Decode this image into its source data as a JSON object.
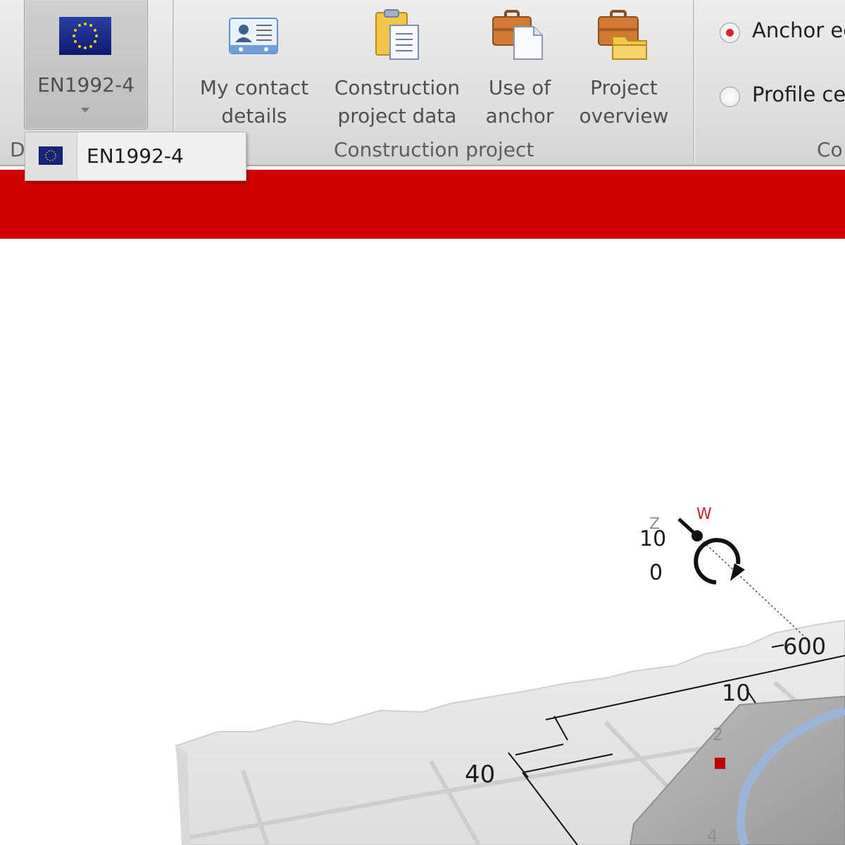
{
  "ribbon": {
    "standard": {
      "label": "EN1992-4",
      "icon": "eu-flag-icon"
    },
    "standard_group_label": "D",
    "construction_group": {
      "label": "Construction project",
      "buttons": [
        {
          "line1": "My contact",
          "line2": "details",
          "icon": "contact-card-icon"
        },
        {
          "line1": "Construction",
          "line2": "project data",
          "icon": "clipboard-document-icon"
        },
        {
          "line1": "Use of",
          "line2": "anchor",
          "icon": "briefcase-document-icon"
        },
        {
          "line1": "Project",
          "line2": "overview",
          "icon": "briefcase-folder-icon"
        }
      ]
    },
    "next_group_label": "Co",
    "radios": [
      {
        "label": "Anchor ec",
        "checked": true
      },
      {
        "label": "Profile ce",
        "checked": false
      }
    ]
  },
  "dropdown": {
    "items": [
      {
        "label": "EN1992-4",
        "icon": "eu-flag-icon"
      }
    ]
  },
  "banner": {
    "color": "#d00000"
  },
  "viewport": {
    "axis": {
      "z_label": "Z",
      "w_label": "W"
    },
    "labels": {
      "d1": "10",
      "d2": "0",
      "d3": "600",
      "d4": "10",
      "d5": "40",
      "d6": "2",
      "d7": "4"
    }
  }
}
